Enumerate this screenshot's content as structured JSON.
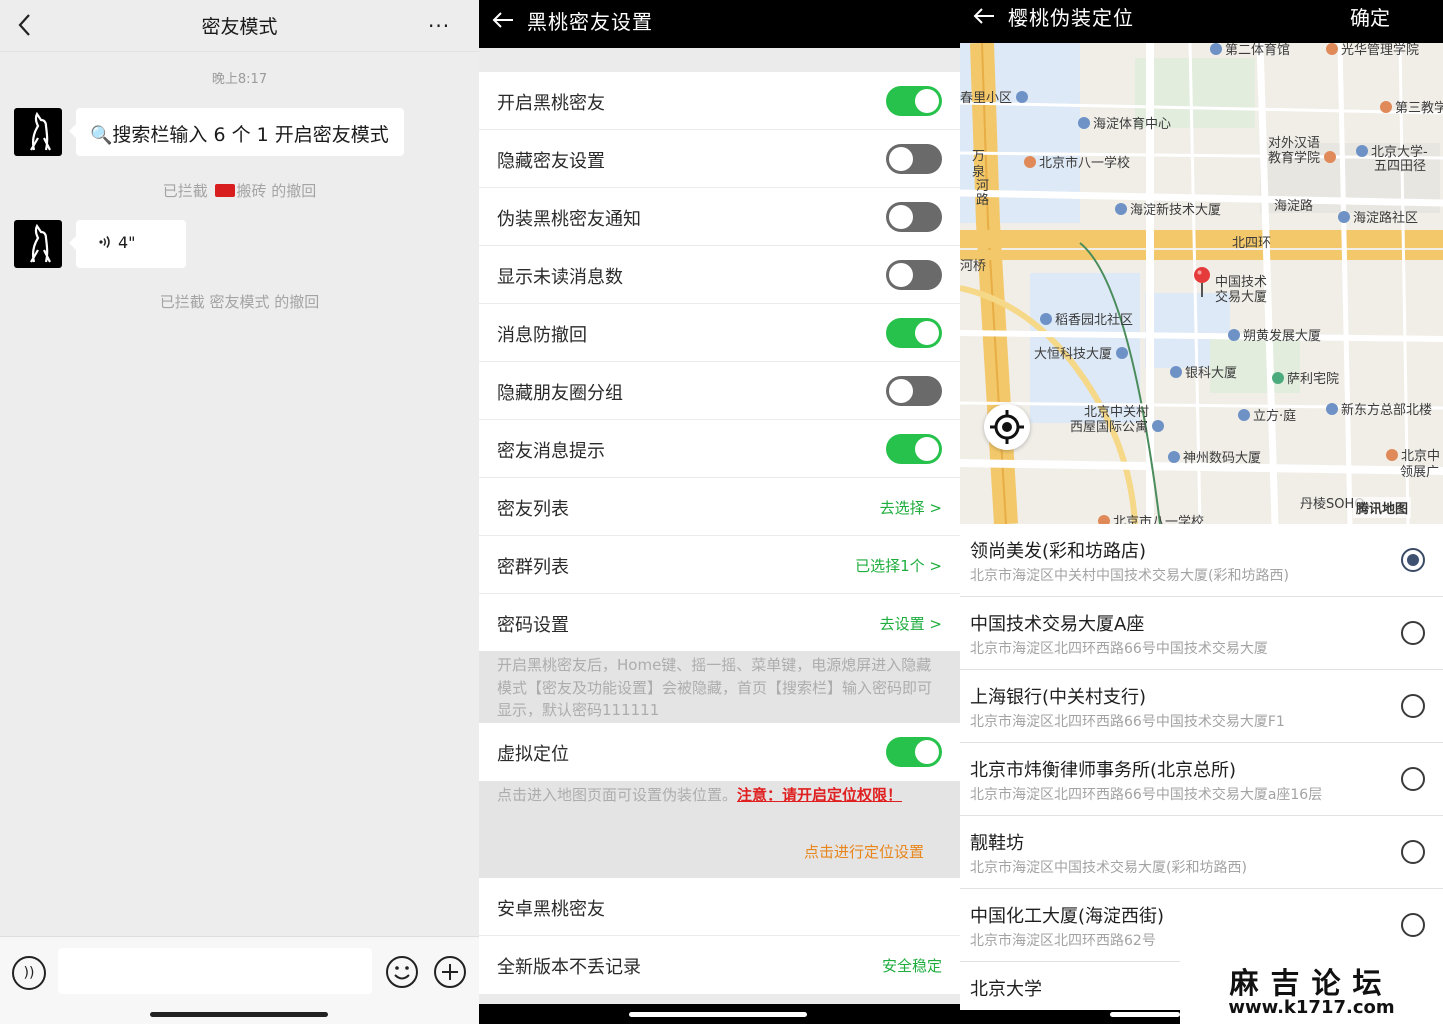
{
  "chat": {
    "title": "密友模式",
    "more": "···",
    "time": "晚上8:17",
    "msg1_icon": "🔍",
    "msg1_text": "搜索栏输入 6 个 1 开启密友模式",
    "notice1_pre": "已拦截",
    "notice1_name": "搬砖 的撤回",
    "msg2_text": "4\"",
    "notice2": "已拦截 密友模式 的撤回",
    "voice_icon": "))",
    "icons": [
      "back-chevron-icon",
      "more-icon",
      "voice-icon",
      "emoji-icon",
      "plus-icon",
      "magnifier-icon",
      "flag-icon"
    ]
  },
  "settings": {
    "title": "黑桃密友设置",
    "rows": [
      {
        "label": "开启黑桃密友",
        "state": "on"
      },
      {
        "label": "隐藏密友设置",
        "state": "off"
      },
      {
        "label": "伪装黑桃密友通知",
        "state": "off"
      },
      {
        "label": "显示未读消息数",
        "state": "off"
      },
      {
        "label": "消息防撤回",
        "state": "on"
      },
      {
        "label": "隐藏朋友圈分组",
        "state": "off"
      },
      {
        "label": "密友消息提示",
        "state": "on"
      },
      {
        "label": "密友列表",
        "link": "去选择 >"
      },
      {
        "label": "密群列表",
        "link": "已选择1个 >"
      },
      {
        "label": "密码设置",
        "link": "去设置 >"
      }
    ],
    "note1": "开启黑桃密友后，Home键、摇一摇、菜单键，电源熄屏进入隐藏模式【密友及功能设置】会被隐藏，首页【搜索栏】输入密码即可显示，默认密码111111",
    "virtual_location": {
      "label": "虚拟定位",
      "state": "on"
    },
    "note2": "点击进入地图页面可设置伪装位置。",
    "note2_warn": "注意：请开启定位权限！",
    "location_setting_link": "点击进行定位设置",
    "android_label": "安卓黑桃密友",
    "record_label": "全新版本不丢记录",
    "record_link": "安全稳定",
    "accent_green": "#27c24c",
    "accent_orange": "#e8861c"
  },
  "location": {
    "title": "樱桃伪装定位",
    "confirm": "确定",
    "map_labels": [
      "第二体育馆",
      "光华管理学院",
      "第三教学",
      "春里小区",
      "海淀体育中心",
      "对外汉语",
      "教育学院",
      "北京大学-",
      "五四田径",
      "万",
      "泉",
      "河",
      "路",
      "北京市八一学校",
      "海淀新技术大厦",
      "海淀路",
      "海淀路社区",
      "北四环",
      "河桥",
      "中国技术",
      "交易大厦",
      "稻香园北社区",
      "朔黄发展大厦",
      "大恒科技大厦",
      "银科大厦",
      "萨利宅院",
      "北京中关村",
      "西屋国际公寓",
      "立方·庭",
      "新东方总部北楼",
      "神州数码大厦",
      "北京中",
      "领展广",
      "丹棱SOHO",
      "北京市八一学校"
    ],
    "map_brand": "腾讯地图",
    "places": [
      {
        "name": "领尚美发(彩和坊路店)",
        "address": "北京市海淀区中关村中国技术交易大厦(彩和坊路西)",
        "selected": true
      },
      {
        "name": "中国技术交易大厦A座",
        "address": "北京市海淀区北四环西路66号中国技术交易大厦",
        "selected": false
      },
      {
        "name": "上海银行(中关村支行)",
        "address": "北京市海淀区北四环西路66号中国技术交易大厦F1",
        "selected": false
      },
      {
        "name": "北京市炜衡律师事务所(北京总所)",
        "address": "北京市海淀区北四环西路66号中国技术交易大厦a座16层",
        "selected": false
      },
      {
        "name": "靓鞋坊",
        "address": "北京市海淀区中国技术交易大厦(彩和坊路西)",
        "selected": false
      },
      {
        "name": "中国化工大厦(海淀西街)",
        "address": "北京市海淀区北四环西路62号",
        "selected": false
      },
      {
        "name": "北京大学",
        "address": "",
        "selected": false
      }
    ],
    "watermark_title": "麻吉论坛",
    "watermark_url": "www.k1717.com"
  }
}
